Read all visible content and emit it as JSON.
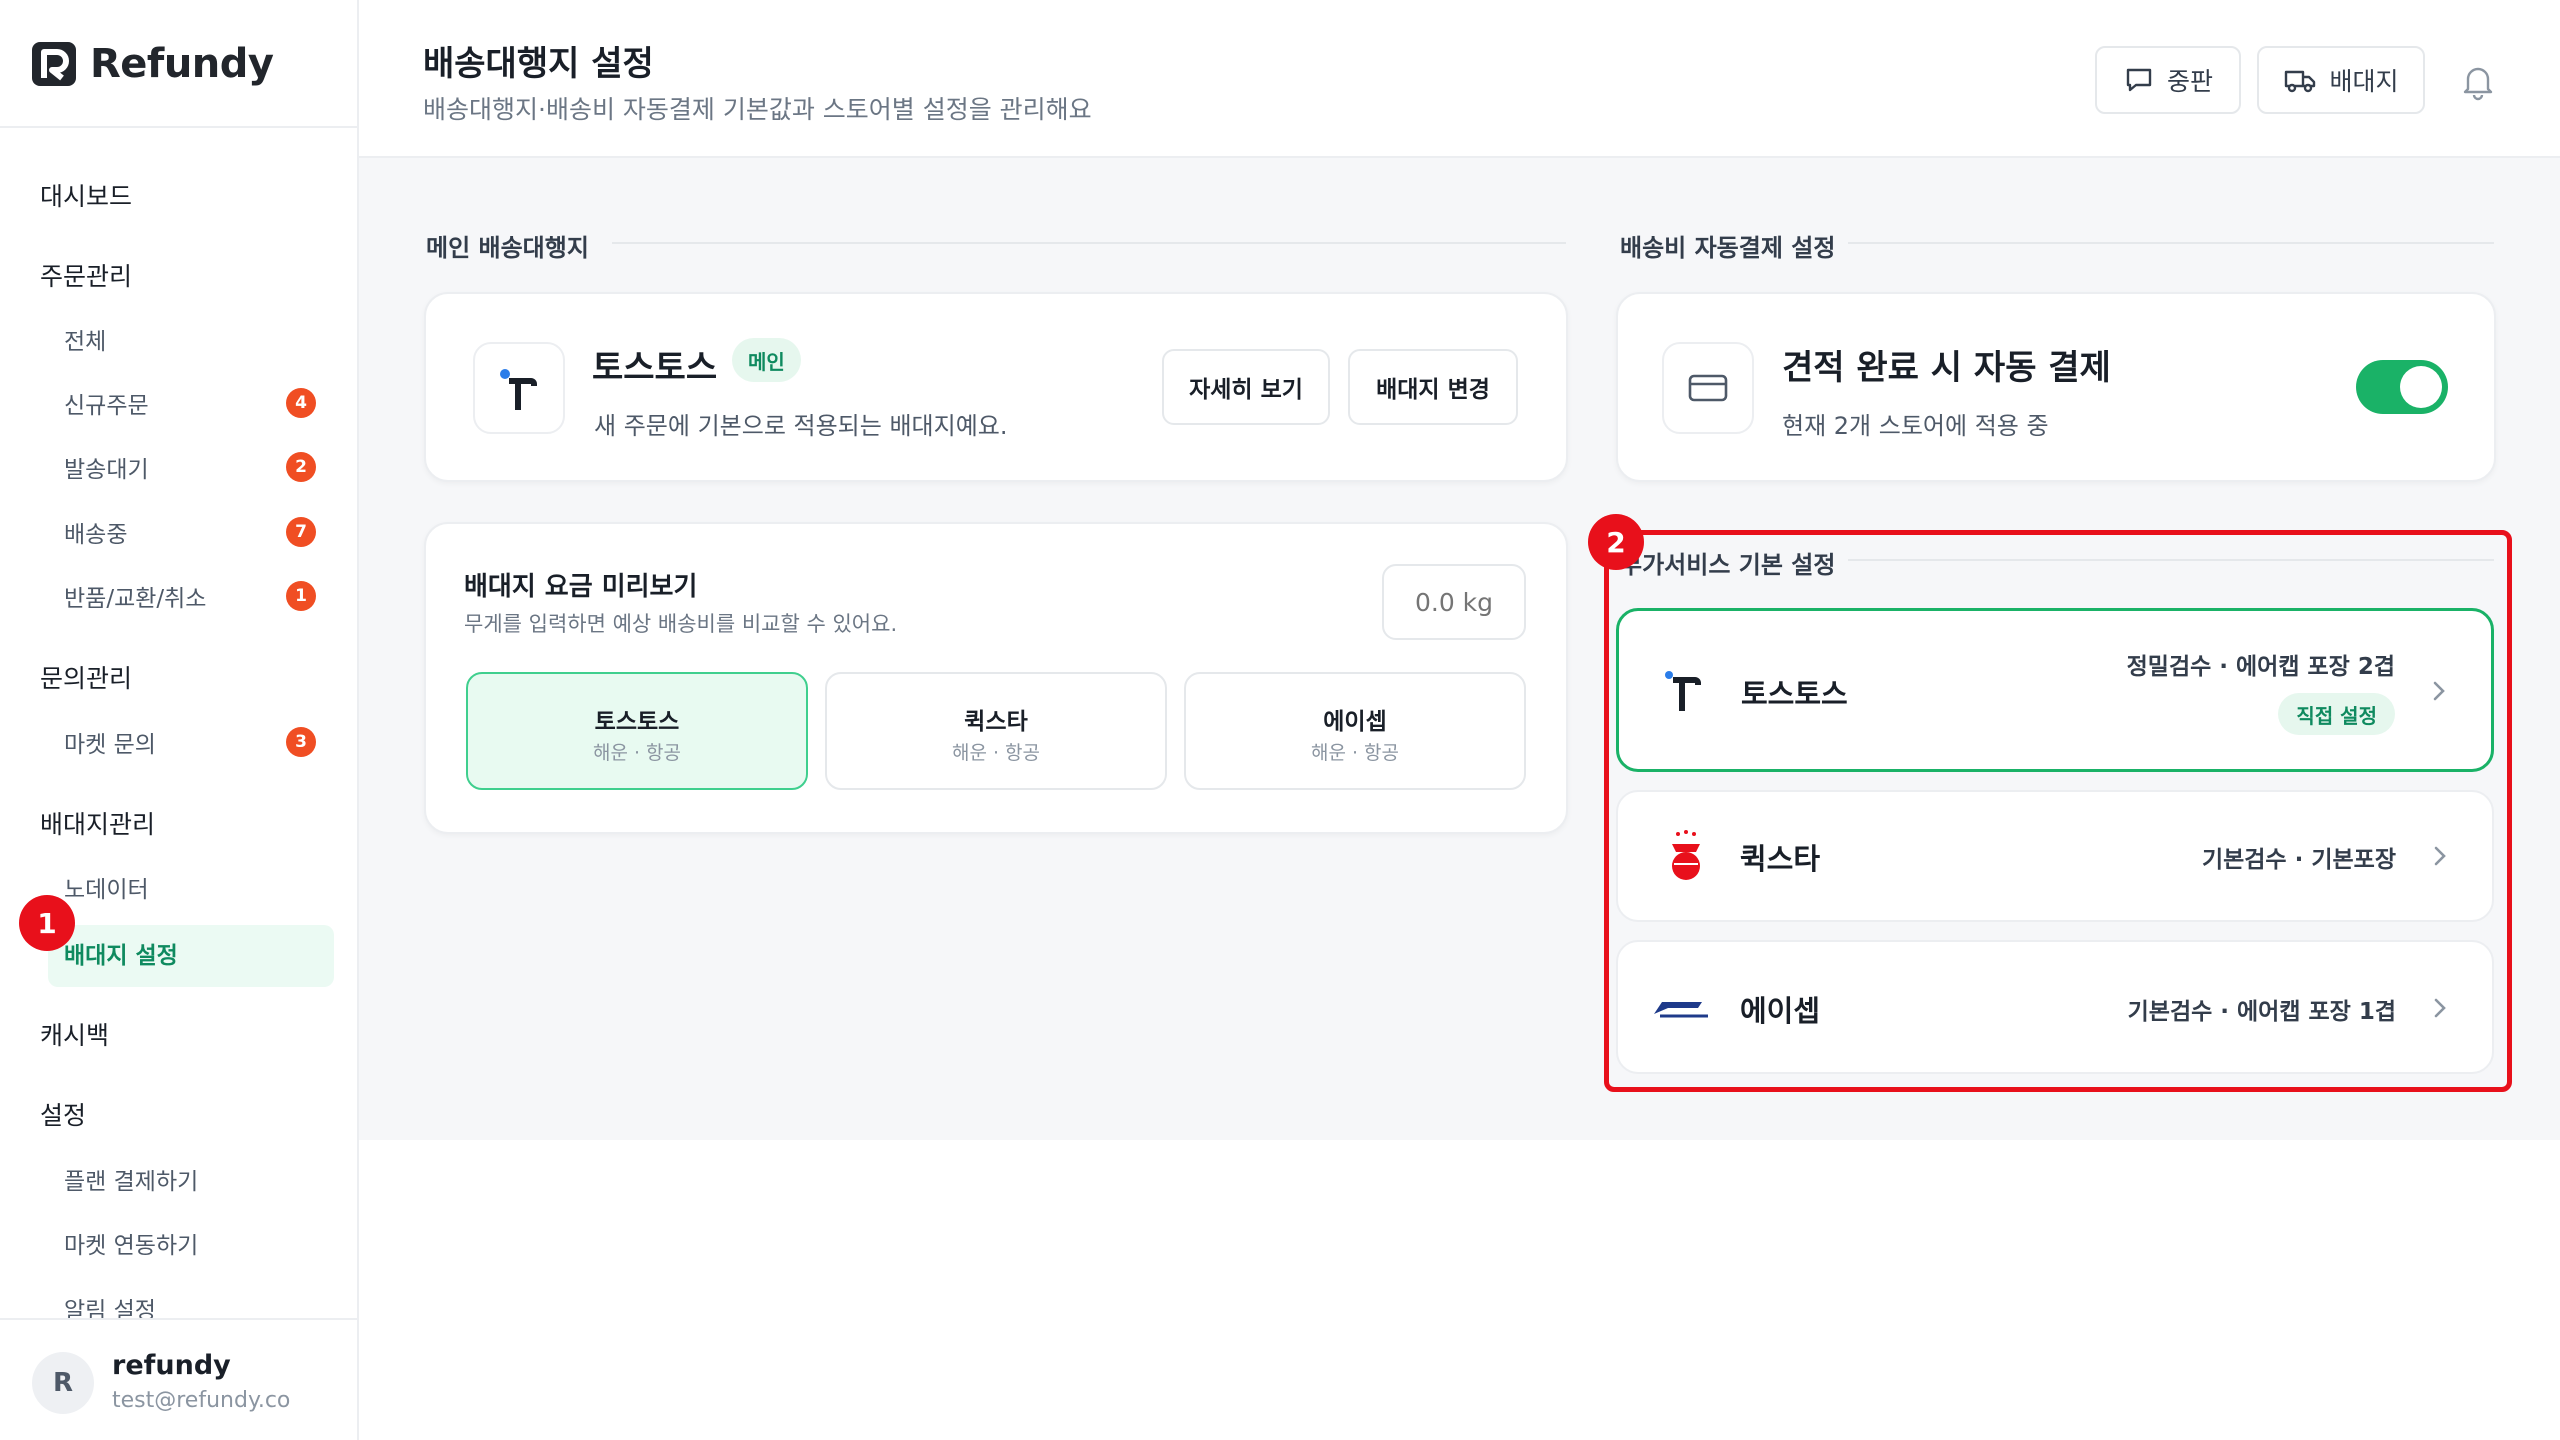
{
  "brand": {
    "name": "Refundy",
    "accent": "#1ab267",
    "badge_color": "#f04e23"
  },
  "sidebar": {
    "dashboard": "대시보드",
    "orders": {
      "title": "주문관리",
      "items": [
        {
          "label": "전체",
          "badge": ""
        },
        {
          "label": "신규주문",
          "badge": "4"
        },
        {
          "label": "발송대기",
          "badge": "2"
        },
        {
          "label": "배송중",
          "badge": "7"
        },
        {
          "label": "반품/교환/취소",
          "badge": "1"
        }
      ]
    },
    "inquiries": {
      "title": "문의관리",
      "items": [
        {
          "label": "마켓 문의",
          "badge": "3"
        }
      ]
    },
    "forwarders": {
      "title": "배대지관리",
      "items": [
        {
          "label": "노데이터"
        },
        {
          "label": "배대지 설정"
        }
      ]
    },
    "cashback": "캐시백",
    "settings": {
      "title": "설정",
      "items": [
        {
          "label": "플랜 결제하기"
        },
        {
          "label": "마켓 연동하기"
        },
        {
          "label": "알림 설정"
        }
      ]
    }
  },
  "user": {
    "initial": "R",
    "name": "refundy",
    "email": "test@refundy.co"
  },
  "header": {
    "title": "배송대행지 설정",
    "subtitle": "배송대행지·배송비 자동결제 기본값과 스토어별 설정을 관리해요",
    "btn_notes": "중판",
    "btn_forwarder": "배대지"
  },
  "main_forwarder": {
    "section": "메인 배송대행지",
    "name": "토스토스",
    "badge": "메인",
    "desc": "새 주문에 기본으로 적용되는 배대지예요.",
    "btn_detail": "자세히 보기",
    "btn_change": "배대지 변경"
  },
  "preview": {
    "title": "배대지 요금 미리보기",
    "desc": "무게를 입력하면 예상 배송비를 비교할 수 있어요.",
    "weight_placeholder": "0.0 kg",
    "options": [
      {
        "name": "토스토스",
        "sub": "해운 · 항공",
        "selected": true
      },
      {
        "name": "퀵스타",
        "sub": "해운 · 항공",
        "selected": false
      },
      {
        "name": "에이셉",
        "sub": "해운 · 항공",
        "selected": false
      }
    ]
  },
  "autopay": {
    "section": "배송비 자동결제 설정",
    "title": "견적 완료 시 자동 결제",
    "desc": "현재 2개 스토어에 적용 중",
    "enabled": true
  },
  "addon": {
    "section": "부가서비스 기본 설정",
    "rows": [
      {
        "name": "토스토스",
        "desc": "정밀검수 · 에어캡 포장 2겹",
        "tag": "직접 설정",
        "selected": true
      },
      {
        "name": "퀵스타",
        "desc": "기본검수 · 기본포장",
        "tag": "",
        "selected": false
      },
      {
        "name": "에이셉",
        "desc": "기본검수 · 에어캡 포장 1겹",
        "tag": "",
        "selected": false
      }
    ]
  },
  "annotations": {
    "marker_1": "1",
    "marker_2": "2",
    "highlight_color": "#e8101b"
  }
}
